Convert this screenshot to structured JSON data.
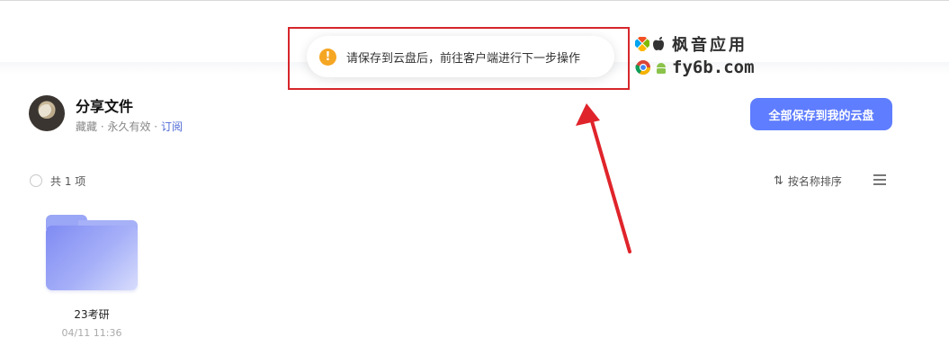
{
  "toast": {
    "icon": "warning-icon",
    "message": "请保存到云盘后，前往客户端进行下一步操作"
  },
  "watermark": {
    "line1": "枫音应用",
    "line2": "fy6b.com"
  },
  "share": {
    "title": "分享文件",
    "owner": "藏藏",
    "separator1": " · ",
    "validity": "永久有效",
    "separator2": " · ",
    "subscribe_label": "订阅",
    "save_all_label": "全部保存到我的云盘"
  },
  "toolbar": {
    "count_text": "共 1 项",
    "sort_label": "按名称排序"
  },
  "files": [
    {
      "name": "23考研",
      "date": "04/11 11:36",
      "icon": "folder-icon"
    }
  ],
  "colors": {
    "accent": "#5f7dff",
    "warning": "#f5a623",
    "annotation_red": "#d6262b"
  }
}
